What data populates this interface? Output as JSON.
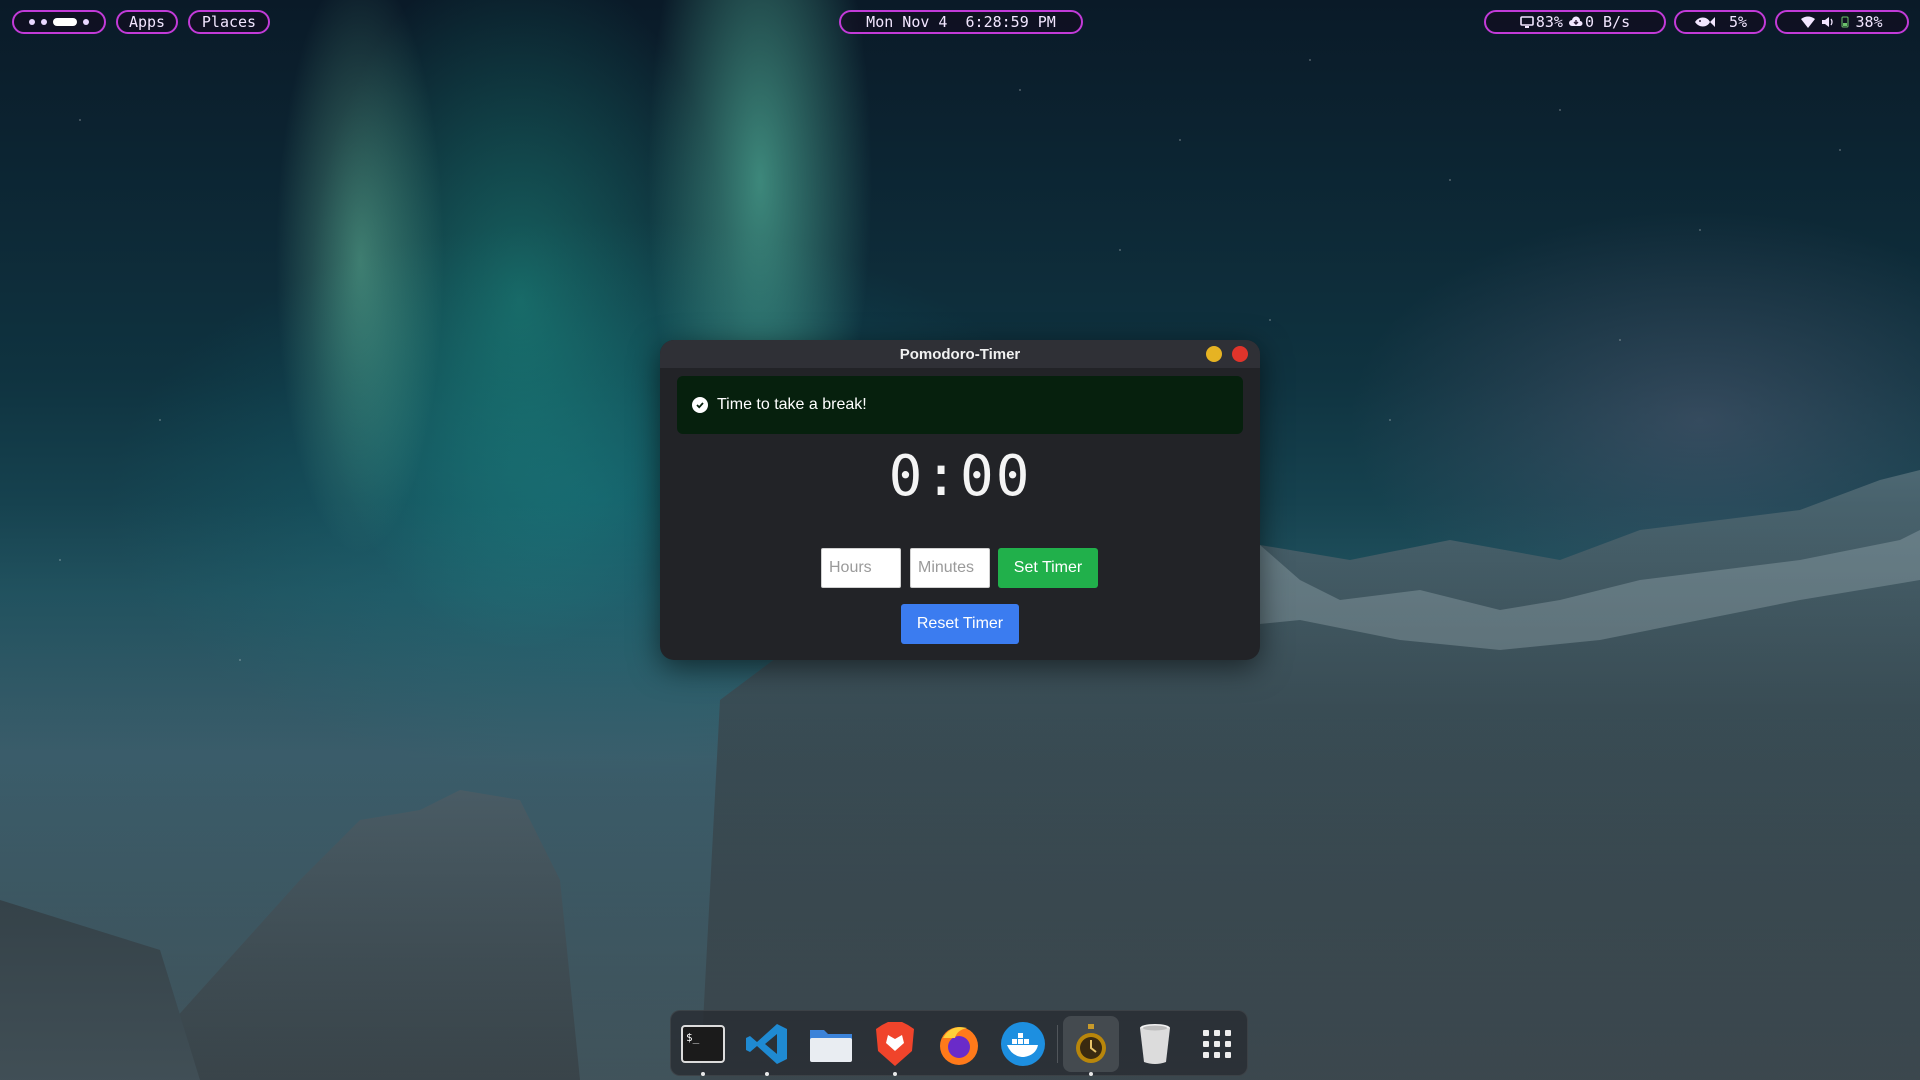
{
  "topbar": {
    "apps_label": "Apps",
    "places_label": "Places",
    "clock": "Mon Nov 4  6:28:59 PM",
    "cpu": "83%",
    "net": "0 B/s",
    "fish_value": "5%",
    "battery": "38%"
  },
  "window": {
    "title": "Pomodoro-Timer",
    "alert_text": "Time to take a break!",
    "timer_display": "0:00",
    "hours_placeholder": "Hours",
    "minutes_placeholder": "Minutes",
    "set_label": "Set Timer",
    "reset_label": "Reset Timer"
  },
  "dock": {
    "items": [
      {
        "icon": "terminal-icon",
        "running": true
      },
      {
        "icon": "vscode-icon",
        "running": true
      },
      {
        "icon": "files-icon",
        "running": false
      },
      {
        "icon": "brave-icon",
        "running": true
      },
      {
        "icon": "firefox-icon",
        "running": false
      },
      {
        "icon": "docker-icon",
        "running": false
      },
      {
        "icon": "pomodoro-timer-icon",
        "running": true,
        "active": true
      },
      {
        "icon": "trash-icon",
        "running": false
      },
      {
        "icon": "app-grid-icon",
        "running": false
      }
    ]
  },
  "colors": {
    "panel_border": "#c23bd8",
    "set_button": "#21b04b",
    "reset_button": "#3b7cf0",
    "alert_bg": "#06200d"
  }
}
